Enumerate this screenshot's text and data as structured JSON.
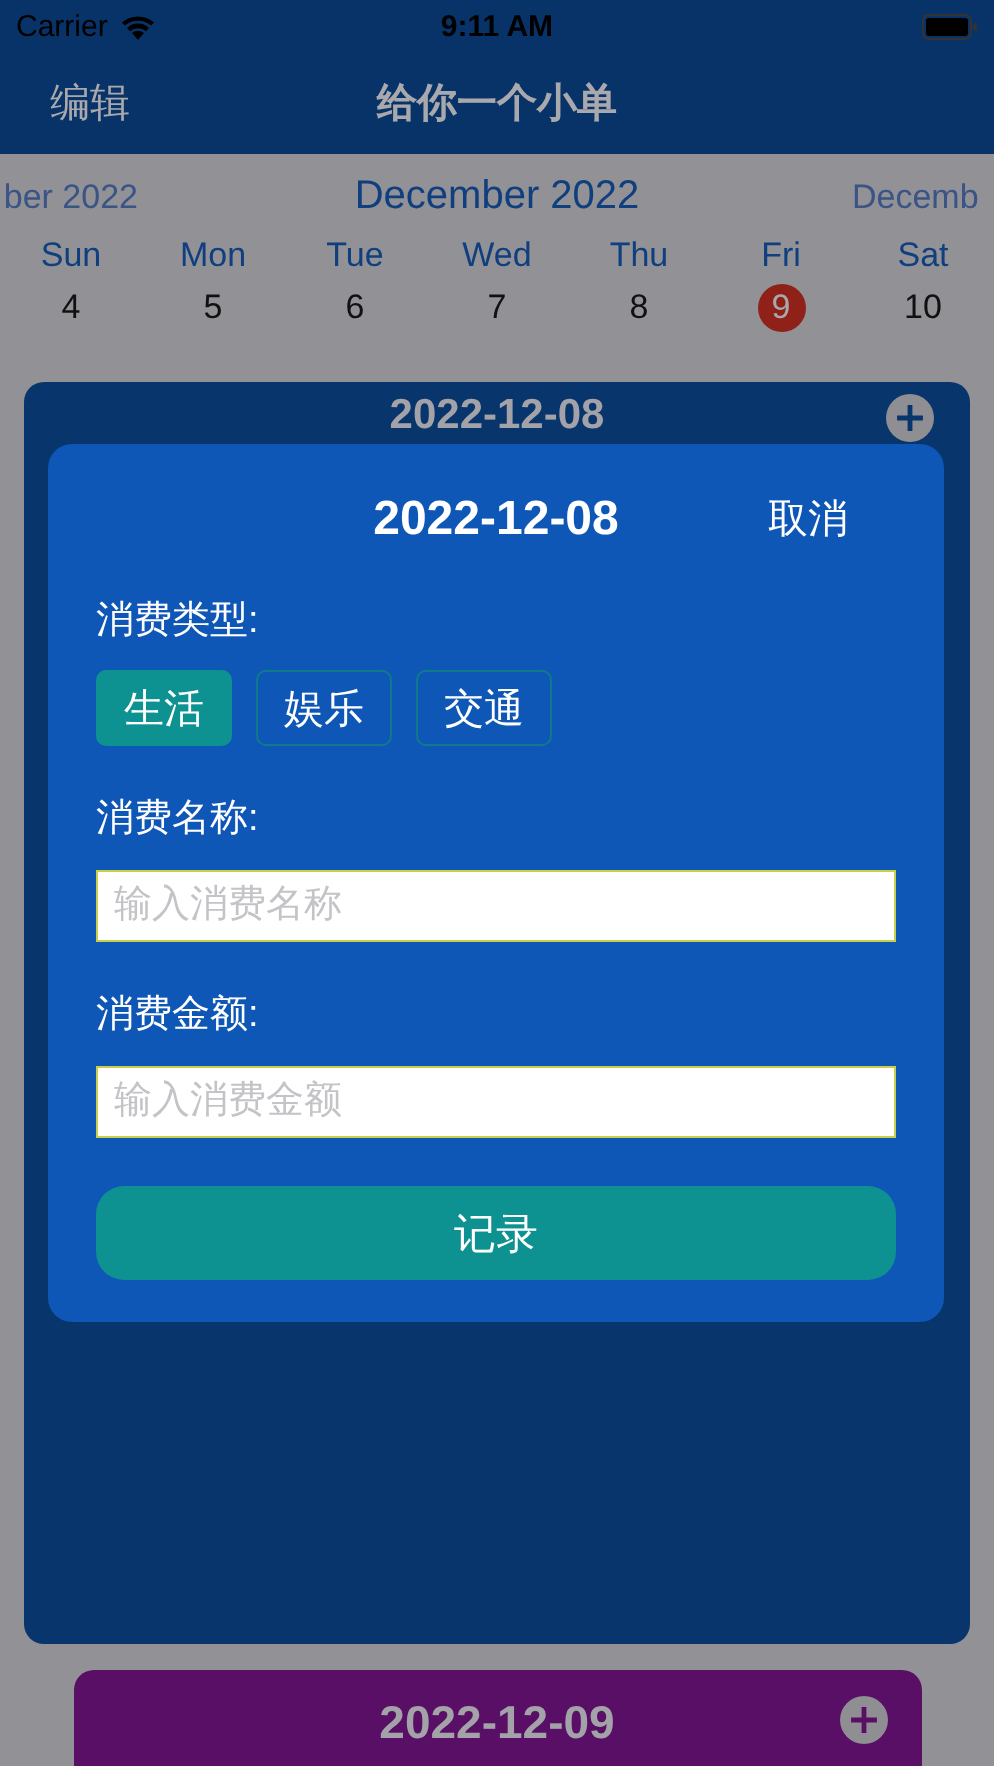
{
  "status_bar": {
    "carrier": "Carrier",
    "time": "9:11 AM"
  },
  "nav": {
    "left_button": "编辑",
    "title": "给你一个小单"
  },
  "calendar": {
    "prev_month": "ber 2022",
    "month": "December 2022",
    "next_month": "Decemb",
    "days": [
      {
        "weekday": "Sun",
        "date": "4",
        "selected": false
      },
      {
        "weekday": "Mon",
        "date": "5",
        "selected": false
      },
      {
        "weekday": "Tue",
        "date": "6",
        "selected": false
      },
      {
        "weekday": "Wed",
        "date": "7",
        "selected": false
      },
      {
        "weekday": "Thu",
        "date": "8",
        "selected": false
      },
      {
        "weekday": "Fri",
        "date": "9",
        "selected": true
      },
      {
        "weekday": "Sat",
        "date": "10",
        "selected": false
      }
    ]
  },
  "day_cards": [
    {
      "date": "2022-12-08",
      "color": "#08356b"
    },
    {
      "date": "2022-12-09",
      "color": "#580f65"
    }
  ],
  "dialog": {
    "title": "2022-12-08",
    "cancel": "取消",
    "type_label": "消费类型:",
    "types": [
      {
        "label": "生活",
        "selected": true
      },
      {
        "label": "娱乐",
        "selected": false
      },
      {
        "label": "交通",
        "selected": false
      }
    ],
    "name_label": "消费名称:",
    "name_placeholder": "输入消费名称",
    "amount_label": "消费金额:",
    "amount_placeholder": "输入消费金额",
    "submit": "记录"
  }
}
